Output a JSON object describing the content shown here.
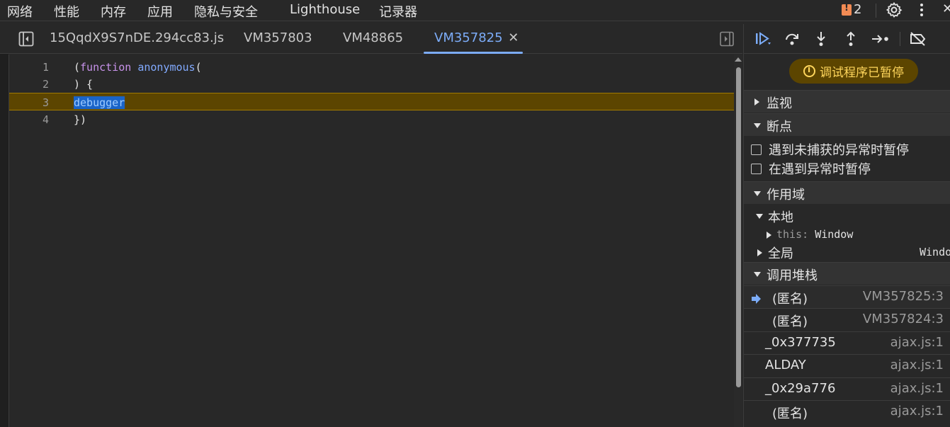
{
  "top_menu": {
    "items": [
      "网络",
      "性能",
      "内存",
      "应用",
      "隐私与安全",
      "Lighthouse",
      "记录器"
    ],
    "issues_count": "2"
  },
  "tabs": [
    {
      "label": "15QqdX9S7nDE.294cc83.js",
      "active": false
    },
    {
      "label": "VM357803",
      "active": false
    },
    {
      "label": "VM48865",
      "active": false
    },
    {
      "label": "VM357825",
      "active": true,
      "close": "✕"
    }
  ],
  "editor": {
    "lines": [
      {
        "num": "1",
        "tokens": [
          {
            "t": "(",
            "c": "plain"
          },
          {
            "t": "function",
            "c": "kw"
          },
          {
            "t": " ",
            "c": "plain"
          },
          {
            "t": "anonymous",
            "c": "fn"
          },
          {
            "t": "(",
            "c": "plain"
          }
        ]
      },
      {
        "num": "2",
        "tokens": [
          {
            "t": ") {",
            "c": "plain"
          }
        ]
      },
      {
        "num": "3",
        "tokens": [
          {
            "t": "debugger",
            "c": "dbg-sel"
          }
        ],
        "paused": true
      },
      {
        "num": "4",
        "tokens": [
          {
            "t": "})",
            "c": "plain"
          }
        ]
      }
    ]
  },
  "debugger": {
    "paused_label": "调试程序已暂停",
    "sections": {
      "watch": "监视",
      "breakpoints": "断点",
      "scope": "作用域",
      "callstack": "调用堆栈"
    },
    "breakpoint_options": [
      {
        "label": "遇到未捕获的异常时暂停",
        "checked": false
      },
      {
        "label": "在遇到异常时暂停",
        "checked": false
      }
    ],
    "scope": {
      "local_label": "本地",
      "this_key": "this",
      "this_sep": ":",
      "this_value": "Window",
      "global_label": "全局",
      "global_value": "Windo"
    },
    "call_stack": [
      {
        "name": "(匿名)",
        "location": "VM357825:3",
        "current": true
      },
      {
        "name": "(匿名)",
        "location": "VM357824:3",
        "current": false
      },
      {
        "name": "_0x377735",
        "location": "ajax.js:1",
        "current": false
      },
      {
        "name": "ALDAY",
        "location": "ajax.js:1",
        "current": false
      },
      {
        "name": "_0x29a776",
        "location": "ajax.js:1",
        "current": false
      },
      {
        "name": "(匿名)",
        "location": "ajax.js:1",
        "current": false
      }
    ]
  },
  "colors": {
    "accent": "#7cacf8",
    "paused_bg": "#5c4500",
    "paused_text": "#ffd65c",
    "issue_flag": "#f28b54"
  }
}
